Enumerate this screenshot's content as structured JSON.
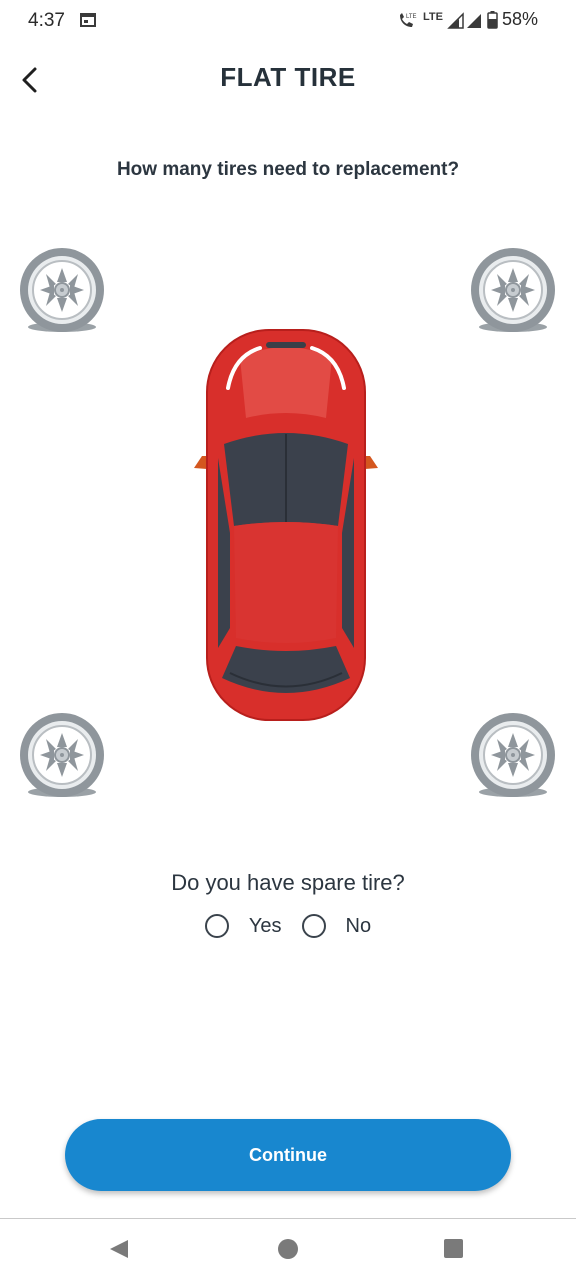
{
  "status_bar": {
    "time": "4:37",
    "network_label": "LTE",
    "battery_percent": "58%",
    "icons": [
      "calendar-icon",
      "call-lte-icon",
      "signal-icon",
      "battery-icon"
    ]
  },
  "header": {
    "title": "FLAT TIRE",
    "back_icon": "chevron-left-icon"
  },
  "main": {
    "question": "How many tires need to replacement?",
    "tires": [
      {
        "position": "front-left",
        "icon": "flat-tire-icon"
      },
      {
        "position": "front-right",
        "icon": "flat-tire-icon"
      },
      {
        "position": "rear-left",
        "icon": "flat-tire-icon"
      },
      {
        "position": "rear-right",
        "icon": "flat-tire-icon"
      }
    ],
    "car_icon": "car-top-view",
    "car_color": "#d82f2b",
    "spare_question": "Do you have spare tire?",
    "spare_options": [
      {
        "label": "Yes",
        "selected": false
      },
      {
        "label": "No",
        "selected": false
      }
    ]
  },
  "footer": {
    "continue_label": "Continue",
    "accent_color": "#1887cf"
  },
  "nav_bar": {
    "icons": [
      "nav-back-icon",
      "nav-home-icon",
      "nav-recents-icon"
    ]
  }
}
